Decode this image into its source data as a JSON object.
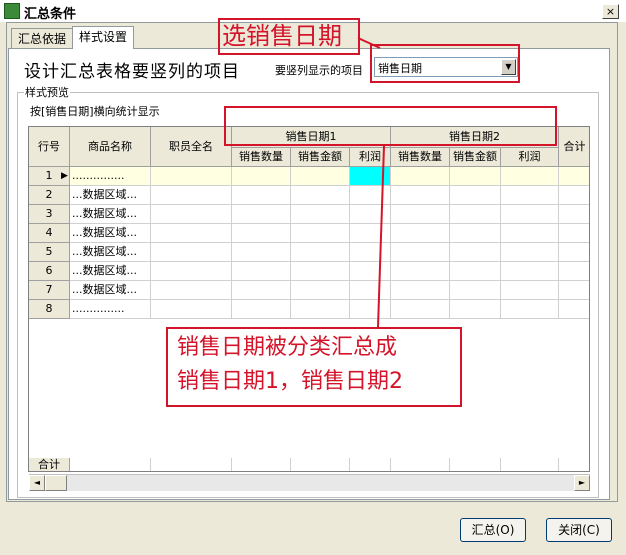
{
  "window": {
    "title": "汇总条件",
    "close_label": "×"
  },
  "tabs": [
    {
      "label": "汇总依据"
    },
    {
      "label": "样式设置"
    }
  ],
  "heading": "设计汇总表格要竖列的项目",
  "vertical_label": "要竖列显示的项目",
  "vertical_select": {
    "value": "销售日期"
  },
  "group_title": "样式预览",
  "description": "按[销售日期]横向统计显示",
  "grid": {
    "col_row": "行号",
    "col_product": "商品名称",
    "col_staff": "职员全名",
    "group1": "销售日期1",
    "group2": "销售日期2",
    "sub": [
      "销售数量",
      "销售金额",
      "利润",
      "销售数量",
      "销售金额",
      "利润"
    ],
    "col_total": "合计",
    "rows": [
      {
        "num": "1",
        "product": "..............."
      },
      {
        "num": "2",
        "product": "...数据区域..."
      },
      {
        "num": "3",
        "product": "...数据区域..."
      },
      {
        "num": "4",
        "product": "...数据区域..."
      },
      {
        "num": "5",
        "product": "...数据区域..."
      },
      {
        "num": "6",
        "product": "...数据区域..."
      },
      {
        "num": "7",
        "product": "...数据区域..."
      },
      {
        "num": "8",
        "product": "..............."
      }
    ],
    "footer_label": "合计"
  },
  "scroll": {
    "left": "◄",
    "right": "►"
  },
  "buttons": {
    "summary": "汇总(O)",
    "close": "关闭(C)"
  },
  "annotations": {
    "top": "选销售日期",
    "bottom_line1": "销售日期被分类汇总成",
    "bottom_line2": "销售日期1，销售日期2"
  },
  "colors": {
    "accent": "#d4142a",
    "selected_cell": "#00ffff"
  }
}
